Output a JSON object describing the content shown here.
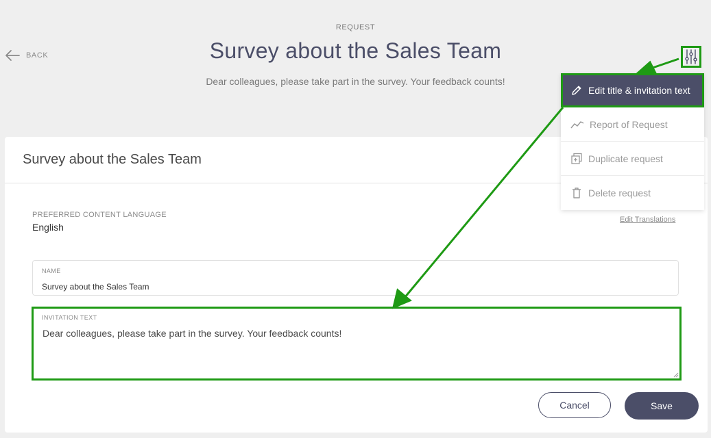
{
  "header": {
    "eyebrow": "REQUEST",
    "title": "Survey about the Sales Team",
    "subtitle": "Dear colleagues, please take part in the survey. Your feedback counts!",
    "back_label": "BACK",
    "settings_icon": "sliders-icon"
  },
  "menu": {
    "items": [
      {
        "label": "Edit title & invitation text",
        "icon": "pencil-icon",
        "active": true
      },
      {
        "label": "Report of Request",
        "icon": "trend-line-icon",
        "active": false
      },
      {
        "label": "Duplicate request",
        "icon": "duplicate-icon",
        "active": false
      },
      {
        "label": "Delete request",
        "icon": "trash-icon",
        "active": false
      }
    ]
  },
  "card": {
    "title": "Survey about the Sales Team",
    "language_label": "PREFERRED CONTENT LANGUAGE",
    "language_value": "English",
    "edit_translations_label": "Edit Translations",
    "name_field": {
      "label": "NAME",
      "value": "Survey about the Sales Team"
    },
    "invitation_field": {
      "label": "INVITATION TEXT",
      "value": "Dear colleagues, please take part in the survey. Your feedback counts!"
    },
    "cancel_label": "Cancel",
    "save_label": "Save"
  },
  "colors": {
    "primary": "#4b4e68",
    "highlight": "#1e9a14",
    "background": "#efefef"
  }
}
